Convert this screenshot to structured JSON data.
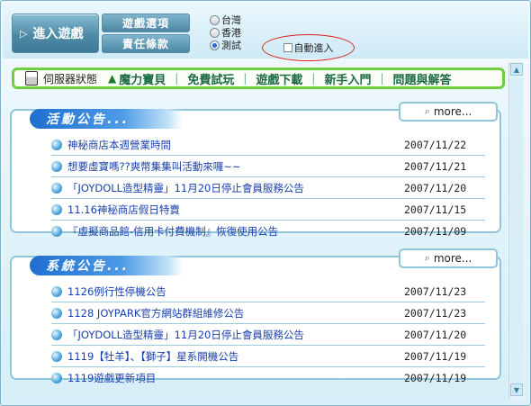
{
  "top": {
    "enter_label": "進入遊戲",
    "options_label": "遊戲選項",
    "terms_label": "責任條款",
    "servers": [
      {
        "label": "台灣",
        "selected": false
      },
      {
        "label": "香港",
        "selected": false
      },
      {
        "label": "測試",
        "selected": true
      }
    ],
    "auto_enter_label": "自動進入"
  },
  "nav": {
    "status_label": "伺服器狀態",
    "links": [
      "魔力寶貝",
      "免費試玩",
      "遊戲下載",
      "新手入門",
      "問題與解答"
    ]
  },
  "events": {
    "header": "活動公告...",
    "more_label": "more...",
    "items": [
      {
        "title": "神秘商店本週營業時間",
        "date": "2007/11/22"
      },
      {
        "title": "想要虛寶嗎??爽幣集集叫活動來囉~~",
        "date": "2007/11/21"
      },
      {
        "title": "「JOYDOLL造型精靈」11月20日停止會員服務公告",
        "date": "2007/11/20"
      },
      {
        "title": "11.16神秘商店假日特賣",
        "date": "2007/11/15"
      },
      {
        "title": "『虛擬商品館-信用卡付費機制』恢復使用公告",
        "date": "2007/11/09"
      }
    ]
  },
  "system": {
    "header": "系統公告...",
    "more_label": "more...",
    "items": [
      {
        "title": "1126例行性停機公告",
        "date": "2007/11/23"
      },
      {
        "title": "1128 JOYPARK官方網站群組維修公告",
        "date": "2007/11/23"
      },
      {
        "title": "「JOYDOLL造型精靈」11月20日停止會員服務公告",
        "date": "2007/11/20"
      },
      {
        "title": "1119【牡羊】、【獅子】星系開機公告",
        "date": "2007/11/19"
      },
      {
        "title": "1119遊戲更新項目",
        "date": "2007/11/19"
      }
    ]
  }
}
